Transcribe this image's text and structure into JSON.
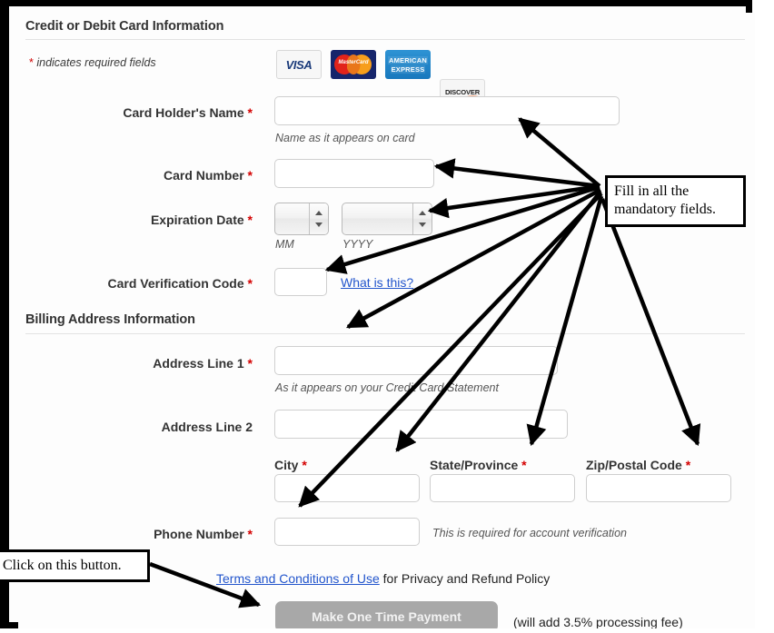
{
  "form": {
    "section1_title": "Credit or Debit Card Information",
    "section2_title": "Billing Address Information",
    "required_note_star": "*",
    "required_note_text": " indicates required fields",
    "card_logos": [
      {
        "name": "visa",
        "label": "VISA"
      },
      {
        "name": "mastercard",
        "label": "MasterCard"
      },
      {
        "name": "american-express",
        "line1": "AMERICAN",
        "line2": "EXPRESS"
      },
      {
        "name": "discover",
        "label": "DISCOVER"
      }
    ],
    "fields": {
      "card_holder_name": {
        "label": "Card Holder's Name",
        "required": "*",
        "hint": "Name as it appears on card",
        "value": ""
      },
      "card_number": {
        "label": "Card Number",
        "required": "*",
        "value": ""
      },
      "expiration_date": {
        "label": "Expiration Date",
        "required": "*",
        "mm_hint": "MM",
        "yyyy_hint": "YYYY",
        "mm_value": "",
        "yyyy_value": ""
      },
      "card_verification_code": {
        "label": "Card Verification Code",
        "required": "*",
        "link": "What is this?",
        "value": ""
      },
      "address_line_1": {
        "label": "Address Line 1",
        "required": "*",
        "hint": "As it appears on your Credit Card Statement",
        "value": ""
      },
      "address_line_2": {
        "label": "Address Line 2",
        "required": "",
        "value": ""
      },
      "city": {
        "label": "City",
        "required": "*",
        "value": ""
      },
      "state_province": {
        "label": "State/Province",
        "required": "*",
        "value": ""
      },
      "zip_postal_code": {
        "label": "Zip/Postal Code",
        "required": "*",
        "value": ""
      },
      "phone_number": {
        "label": "Phone Number",
        "required": "*",
        "hint": "This is required for account verification",
        "value": ""
      }
    },
    "terms_link": "Terms and Conditions of Use",
    "terms_rest": " for Privacy and Refund Policy",
    "pay_button": "Make One Time Payment",
    "fee_text": "(will add 3.5% processing fee)"
  },
  "annotations": {
    "fill_fields": "Fill in all the mandatory fields.",
    "click_button": "Click on this button."
  },
  "colors": {
    "required_star": "#d40000",
    "link": "#2255cc",
    "button_bg": "#a8a8a8",
    "heading": "#333333",
    "frame": "#000000"
  }
}
